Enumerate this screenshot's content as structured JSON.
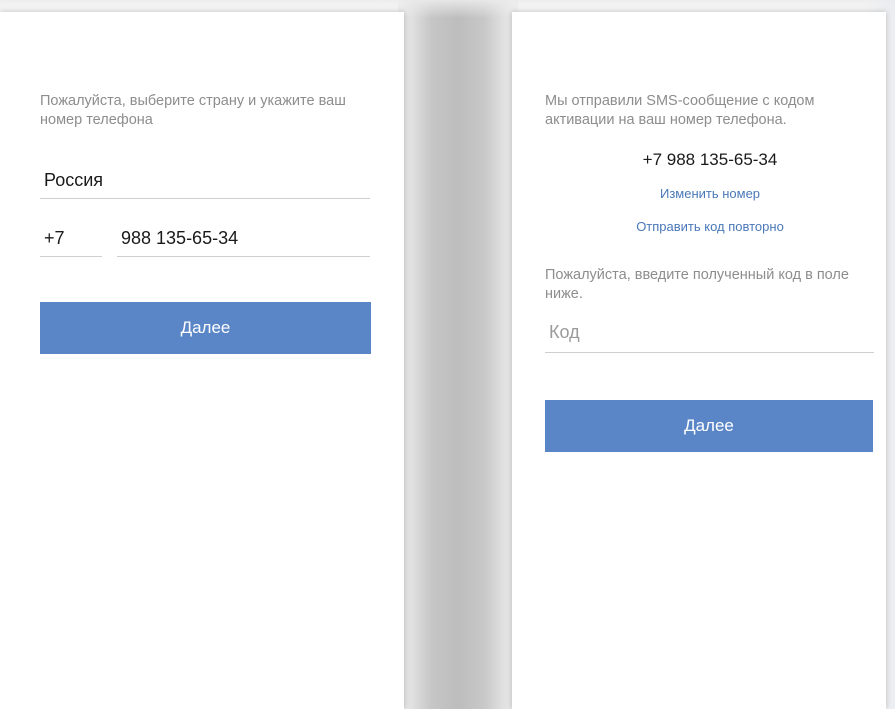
{
  "left_screen": {
    "instruction": "Пожалуйста, выберите страну и укажите ваш номер телефона",
    "country": "Россия",
    "country_code": "+7",
    "phone_number": "988 135-65-34",
    "next_label": "Далее"
  },
  "right_screen": {
    "sms_sent_text": "Мы отправили SMS-сообщение с кодом активации на ваш номер телефона.",
    "phone_display": "+7 988 135-65-34",
    "change_number_label": "Изменить номер",
    "resend_code_label": "Отправить код повторно",
    "code_instruction": "Пожалуйста, введите полученный код в поле ниже.",
    "code_placeholder": "Код",
    "next_label": "Далее"
  },
  "colors": {
    "accent": "#5a86c8",
    "link": "#4a78b8",
    "hint_text": "#8d8d8d",
    "divider": "#cfcfcf"
  }
}
